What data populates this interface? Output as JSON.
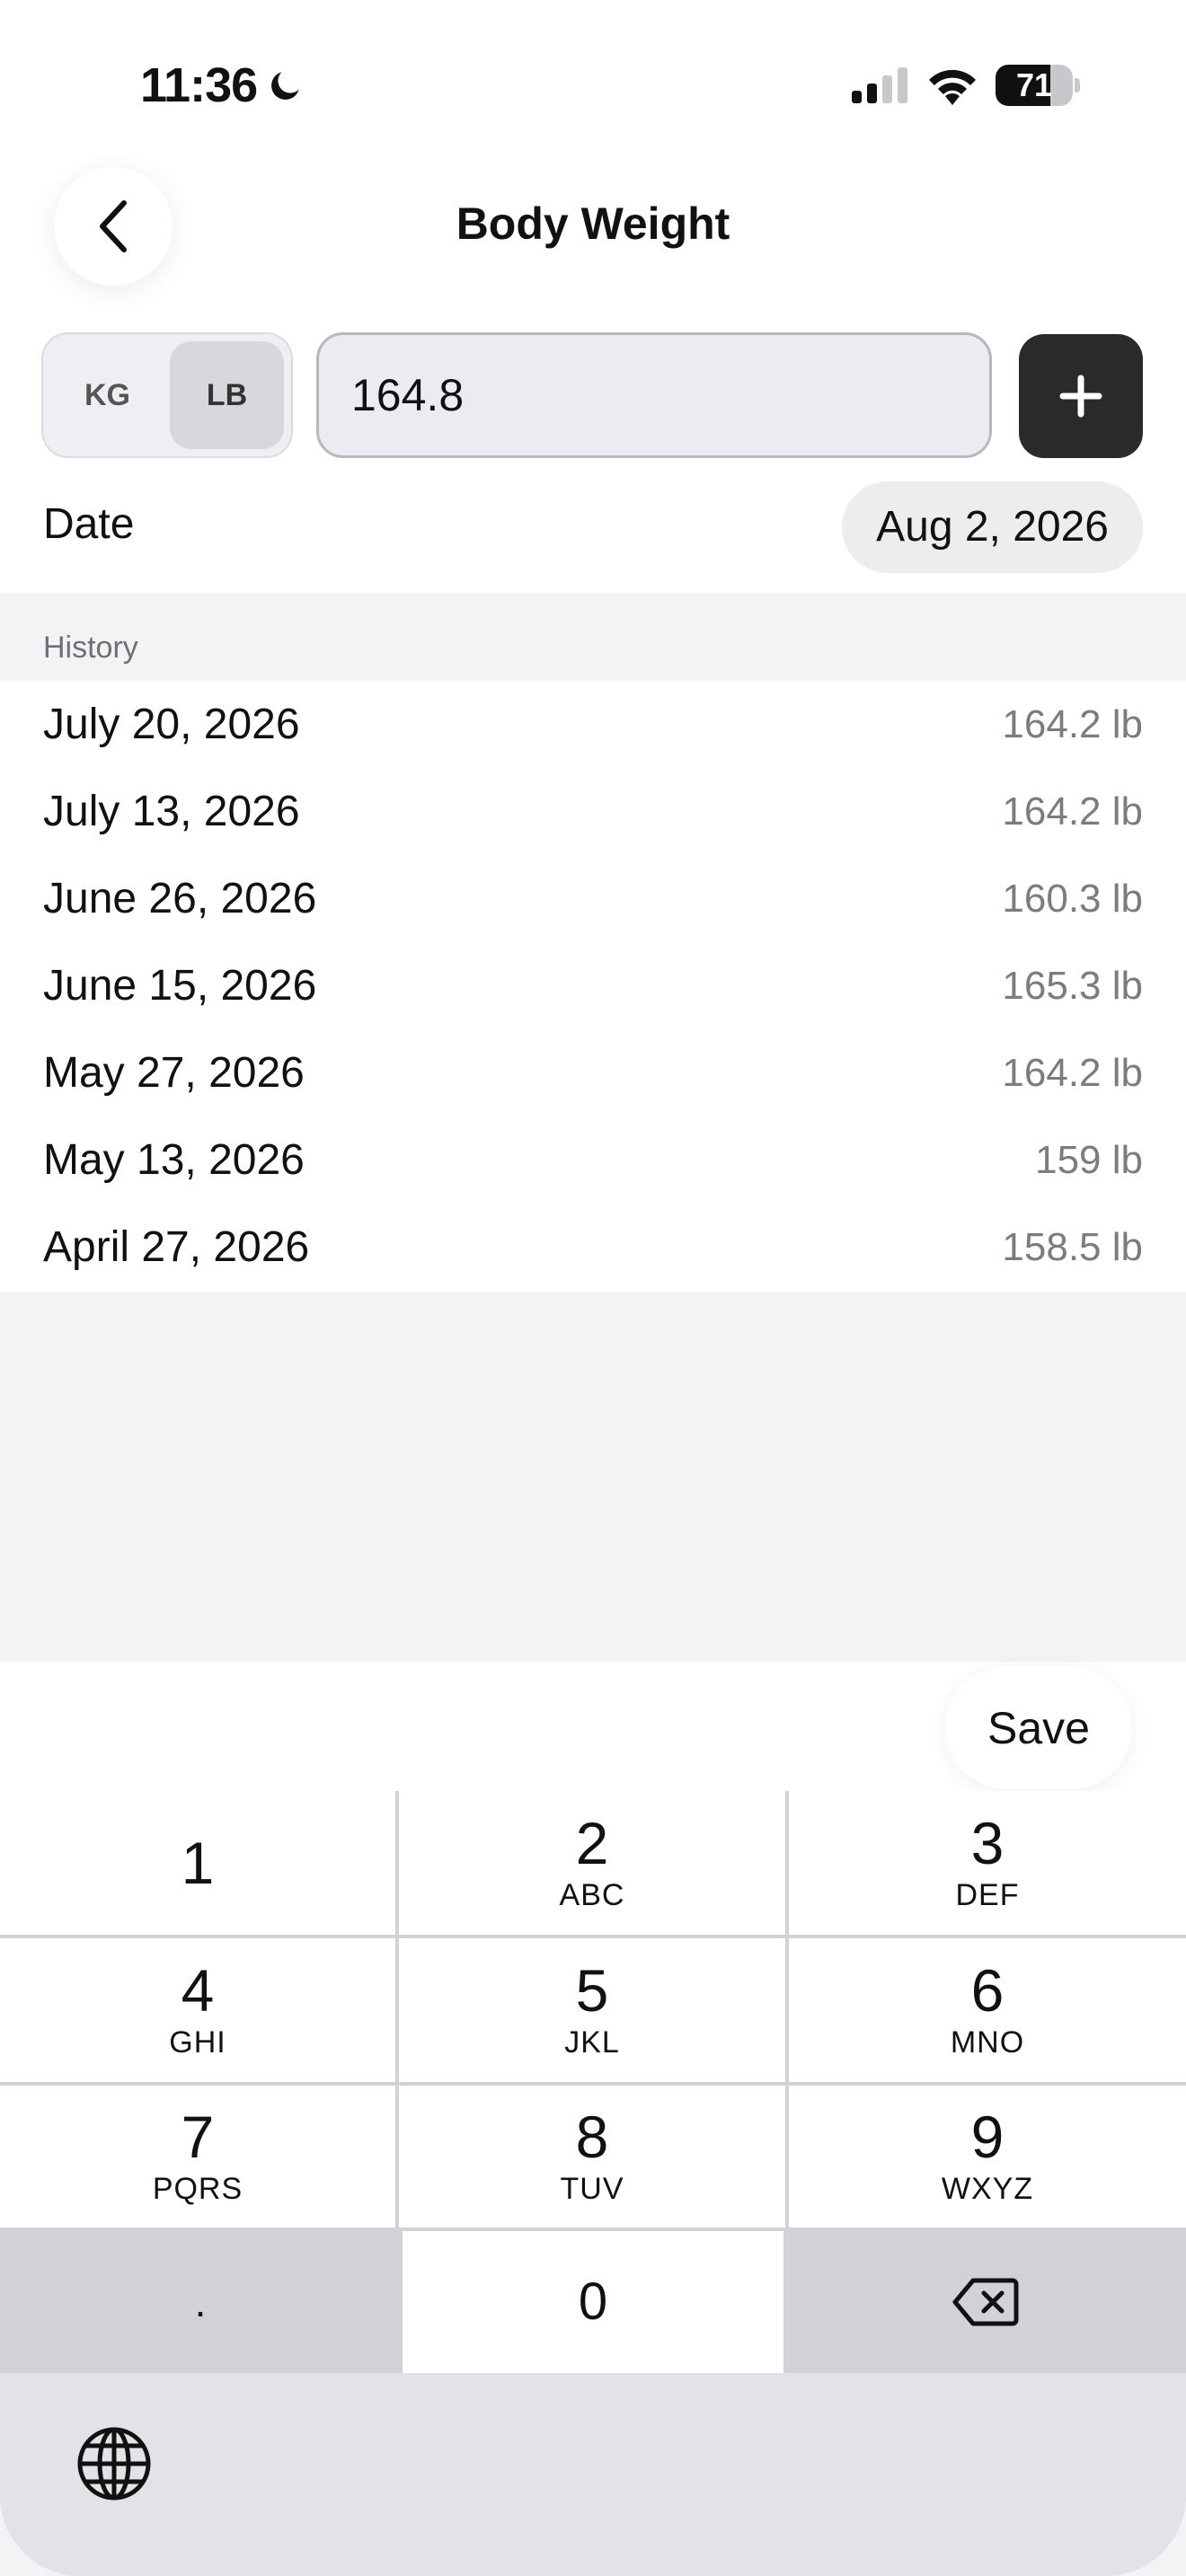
{
  "status_bar": {
    "time": "11:36",
    "battery_level": "71",
    "battery_fraction": 0.71
  },
  "header": {
    "title": "Body Weight"
  },
  "entry": {
    "units": [
      {
        "label": "KG",
        "active": false
      },
      {
        "label": "LB",
        "active": true
      }
    ],
    "weight_value": "164.8",
    "date_label": "Date",
    "date_value": "Aug 2, 2026"
  },
  "history": {
    "header": "History",
    "items": [
      {
        "date": "July 20, 2026",
        "weight": "164.2 lb"
      },
      {
        "date": "July 13, 2026",
        "weight": "164.2 lb"
      },
      {
        "date": "June 26, 2026",
        "weight": "160.3 lb"
      },
      {
        "date": "June 15, 2026",
        "weight": "165.3 lb"
      },
      {
        "date": "May 27, 2026",
        "weight": "164.2 lb"
      },
      {
        "date": "May 13, 2026",
        "weight": "159 lb"
      },
      {
        "date": "April 27, 2026",
        "weight": "158.5 lb"
      }
    ]
  },
  "accessory": {
    "save_label": "Save"
  },
  "keypad": {
    "keys": [
      {
        "num": "1",
        "letters": ""
      },
      {
        "num": "2",
        "letters": "ABC"
      },
      {
        "num": "3",
        "letters": "DEF"
      },
      {
        "num": "4",
        "letters": "GHI"
      },
      {
        "num": "5",
        "letters": "JKL"
      },
      {
        "num": "6",
        "letters": "MNO"
      },
      {
        "num": "7",
        "letters": "PQRS"
      },
      {
        "num": "8",
        "letters": "TUV"
      },
      {
        "num": "9",
        "letters": "WXYZ"
      }
    ],
    "decimal": ".",
    "zero": "0"
  },
  "colors": {
    "accent_button": "#2a2a2a",
    "background": "#f3f3f6"
  }
}
